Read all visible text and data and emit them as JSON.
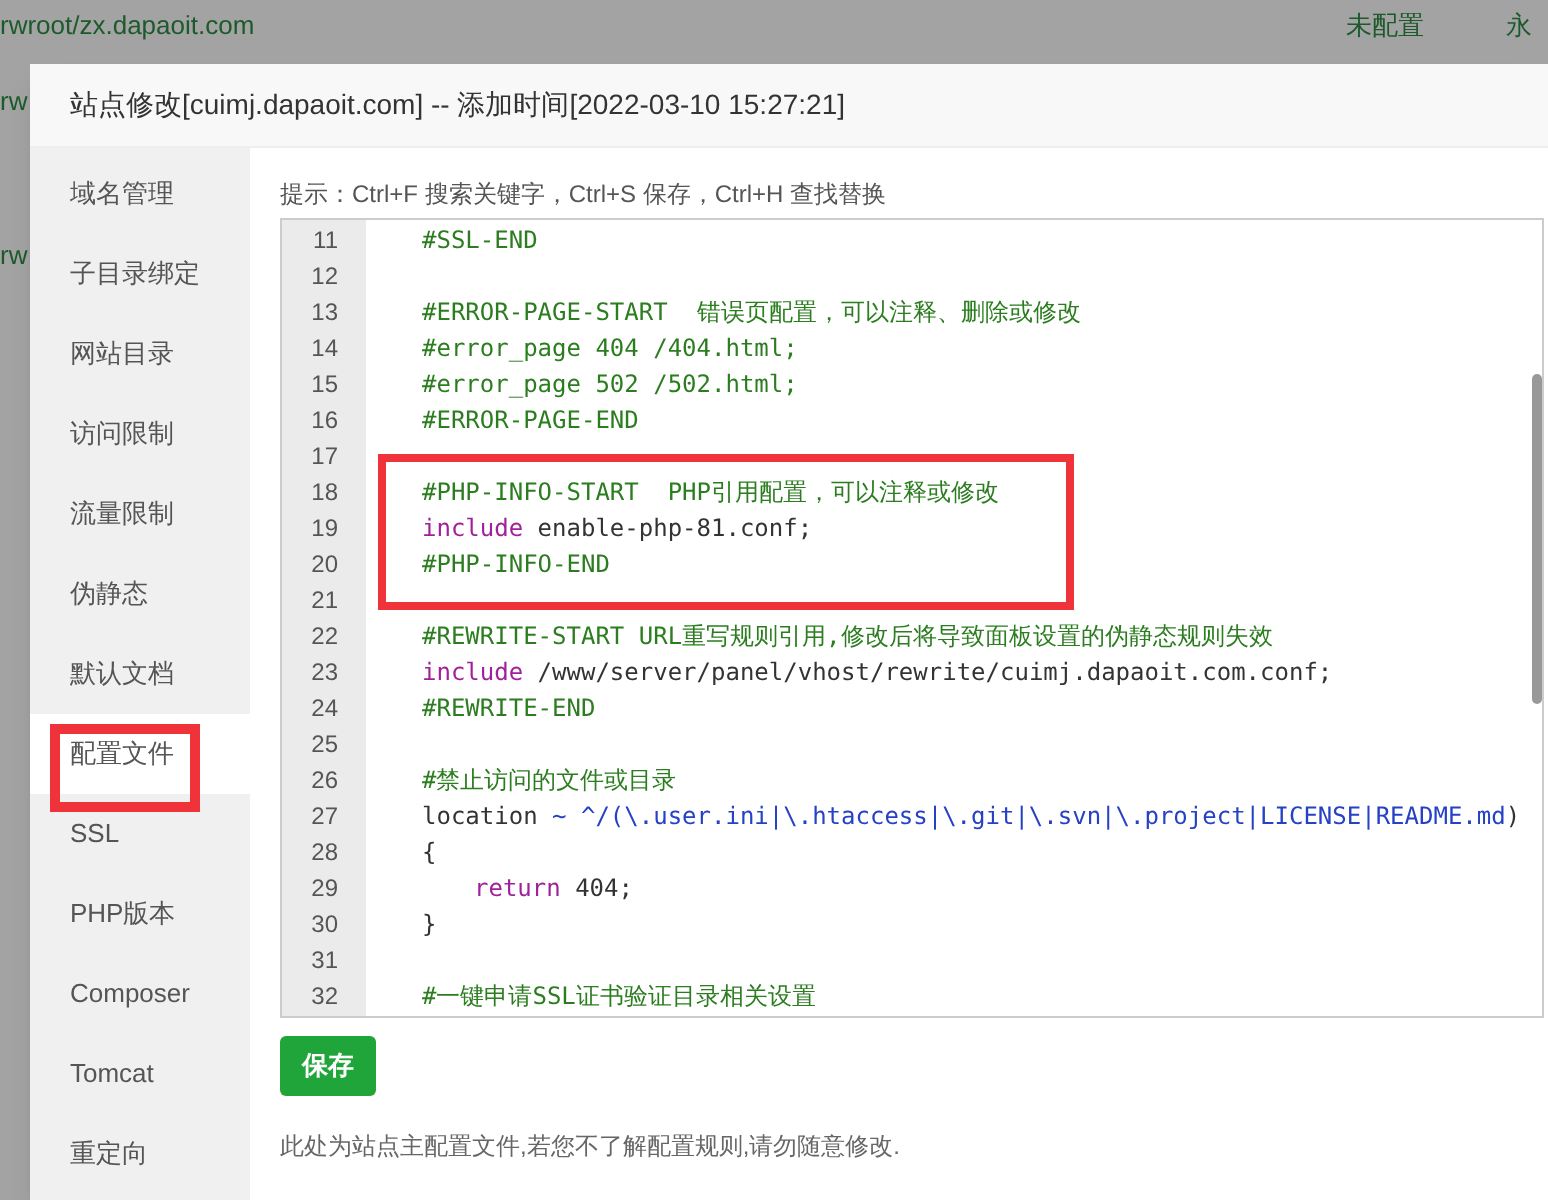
{
  "background_page": {
    "rows": [
      {
        "path": "rwroot/zx.dapaoit.com",
        "status": "未配置",
        "expiry": "永"
      },
      {
        "path": "rw"
      },
      {
        "path": "rw"
      }
    ]
  },
  "dialog": {
    "title": "站点修改[cuimj.dapaoit.com] -- 添加时间[2022-03-10 15:27:21]"
  },
  "sidebar": {
    "items": [
      {
        "label": "域名管理",
        "selected": false,
        "boxed": false
      },
      {
        "label": "子目录绑定",
        "selected": false,
        "boxed": false
      },
      {
        "label": "网站目录",
        "selected": false,
        "boxed": false
      },
      {
        "label": "访问限制",
        "selected": false,
        "boxed": false
      },
      {
        "label": "流量限制",
        "selected": false,
        "boxed": false
      },
      {
        "label": "伪静态",
        "selected": false,
        "boxed": false
      },
      {
        "label": "默认文档",
        "selected": false,
        "boxed": false
      },
      {
        "label": "配置文件",
        "selected": true,
        "boxed": true
      },
      {
        "label": "SSL",
        "selected": false,
        "boxed": false
      },
      {
        "label": "PHP版本",
        "selected": false,
        "boxed": false
      },
      {
        "label": "Composer",
        "selected": false,
        "boxed": false
      },
      {
        "label": "Tomcat",
        "selected": false,
        "boxed": false
      },
      {
        "label": "重定向",
        "selected": false,
        "boxed": false
      }
    ]
  },
  "hint": "提示：Ctrl+F 搜索关键字，Ctrl+S 保存，Ctrl+H 查找替换",
  "code_editor": {
    "blocks": [
      {
        "boxed": false,
        "lines": [
          {
            "number": "11",
            "tokens": [
              {
                "kind": "comment",
                "text": "#SSL-END"
              }
            ]
          },
          {
            "number": "12"
          },
          {
            "number": "13",
            "tokens": [
              {
                "kind": "comment",
                "text": "#ERROR-PAGE-START  错误页配置，可以注释、删除或修改"
              }
            ]
          },
          {
            "number": "14",
            "tokens": [
              {
                "kind": "comment",
                "text": "#error_page 404 /404.html;"
              }
            ]
          },
          {
            "number": "15",
            "tokens": [
              {
                "kind": "comment",
                "text": "#error_page 502 /502.html;"
              }
            ]
          },
          {
            "number": "16",
            "tokens": [
              {
                "kind": "comment",
                "text": "#ERROR-PAGE-END"
              }
            ]
          },
          {
            "number": "17"
          }
        ]
      },
      {
        "boxed": true,
        "lines": [
          {
            "number": "18",
            "tokens": [
              {
                "kind": "comment",
                "text": "#PHP-INFO-START  PHP引用配置，可以注释或修改"
              }
            ]
          },
          {
            "number": "19",
            "tokens": [
              {
                "kind": "keyword",
                "text": "include"
              },
              {
                "kind": "plain",
                "text": " enable-php-81.conf;"
              }
            ]
          },
          {
            "number": "20",
            "tokens": [
              {
                "kind": "comment",
                "text": "#PHP-INFO-END"
              }
            ]
          }
        ]
      },
      {
        "boxed": false,
        "lines": [
          {
            "number": "21"
          },
          {
            "number": "22",
            "tokens": [
              {
                "kind": "comment",
                "text": "#REWRITE-START URL重写规则引用,修改后将导致面板设置的伪静态规则失效"
              }
            ]
          },
          {
            "number": "23",
            "tokens": [
              {
                "kind": "keyword",
                "text": "include"
              },
              {
                "kind": "plain",
                "text": " /www/server/panel/vhost/rewrite/cuimj.dapaoit.com.conf;"
              }
            ]
          },
          {
            "number": "24",
            "tokens": [
              {
                "kind": "comment",
                "text": "#REWRITE-END"
              }
            ]
          },
          {
            "number": "25"
          },
          {
            "number": "26",
            "tokens": [
              {
                "kind": "comment",
                "text": "#禁止访问的文件或目录"
              }
            ]
          },
          {
            "number": "27",
            "tokens": [
              {
                "kind": "plain",
                "text": "location"
              },
              {
                "kind": "regex",
                "text": " ~ ^/(\\.user.ini|\\.htaccess|\\.git|\\.svn|\\.project|LICENSE|README.md"
              },
              {
                "kind": "plain",
                "text": ")"
              }
            ]
          },
          {
            "number": "28",
            "tokens": [
              {
                "kind": "plain",
                "text": "{"
              }
            ]
          },
          {
            "number": "29",
            "indented": true,
            "tokens": [
              {
                "kind": "keyword",
                "text": "return"
              },
              {
                "kind": "plain",
                "text": " 404;"
              }
            ]
          },
          {
            "number": "30",
            "tokens": [
              {
                "kind": "plain",
                "text": "}"
              }
            ]
          },
          {
            "number": "31"
          },
          {
            "number": "32",
            "tokens": [
              {
                "kind": "comment",
                "text": "#一键申请SSL证书验证目录相关设置"
              }
            ]
          }
        ]
      }
    ]
  },
  "save_button": "保存",
  "note": "此处为站点主配置文件,若您不了解配置规则,请勿随意修改."
}
